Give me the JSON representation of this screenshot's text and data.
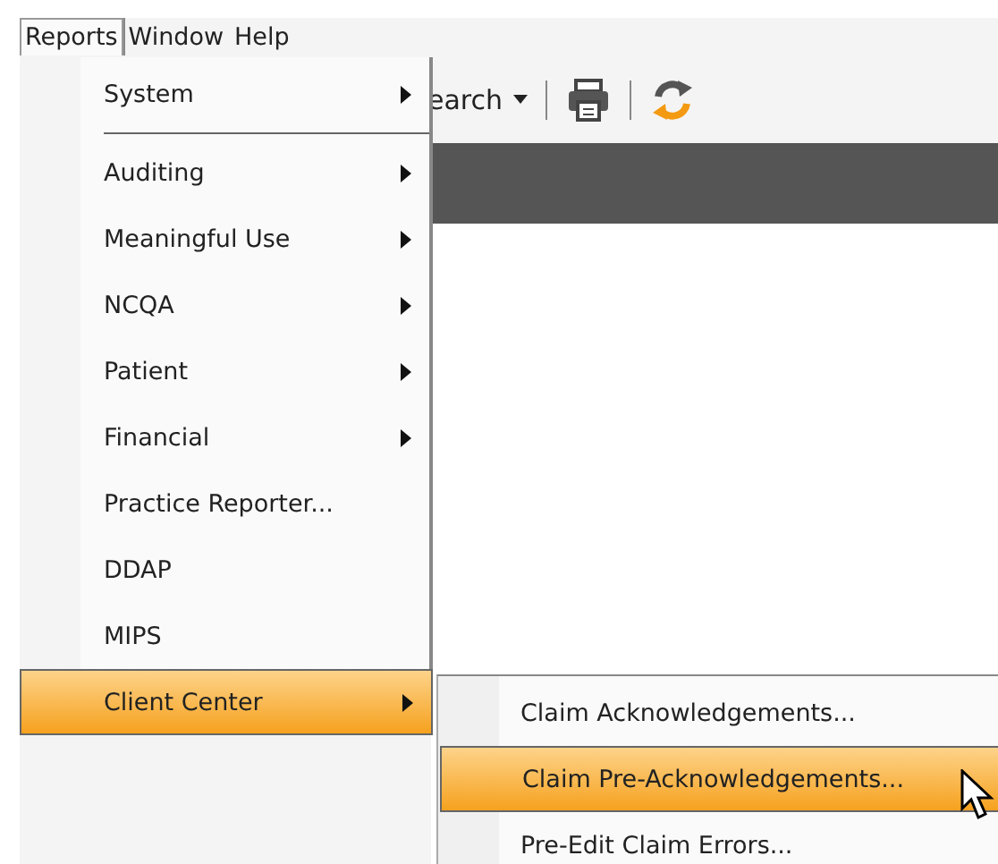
{
  "menu_bar": [
    {
      "label": "Reports",
      "selected": true
    },
    {
      "label": "Window",
      "selected": false
    },
    {
      "label": "Help",
      "selected": false
    }
  ],
  "toolbar": {
    "search_label": "earch"
  },
  "reports_menu": [
    {
      "label": "System",
      "submenu": true,
      "selected": false,
      "separator_after": true
    },
    {
      "label": "Auditing",
      "submenu": true,
      "selected": false,
      "separator_after": false
    },
    {
      "label": "Meaningful Use",
      "submenu": true,
      "selected": false,
      "separator_after": false
    },
    {
      "label": "NCQA",
      "submenu": true,
      "selected": false,
      "separator_after": false
    },
    {
      "label": "Patient",
      "submenu": true,
      "selected": false,
      "separator_after": false
    },
    {
      "label": "Financial",
      "submenu": true,
      "selected": false,
      "separator_after": false
    },
    {
      "label": "Practice Reporter...",
      "submenu": false,
      "selected": false,
      "separator_after": false
    },
    {
      "label": "DDAP",
      "submenu": false,
      "selected": false,
      "separator_after": false
    },
    {
      "label": "MIPS",
      "submenu": false,
      "selected": false,
      "separator_after": false
    },
    {
      "label": "Client Center",
      "submenu": true,
      "selected": true,
      "separator_after": false
    }
  ],
  "client_center_menu": [
    {
      "label": "Claim Acknowledgements...",
      "selected": false
    },
    {
      "label": "Claim Pre-Acknowledgements...",
      "selected": true
    },
    {
      "label": "Pre-Edit Claim Errors...",
      "selected": false
    }
  ]
}
